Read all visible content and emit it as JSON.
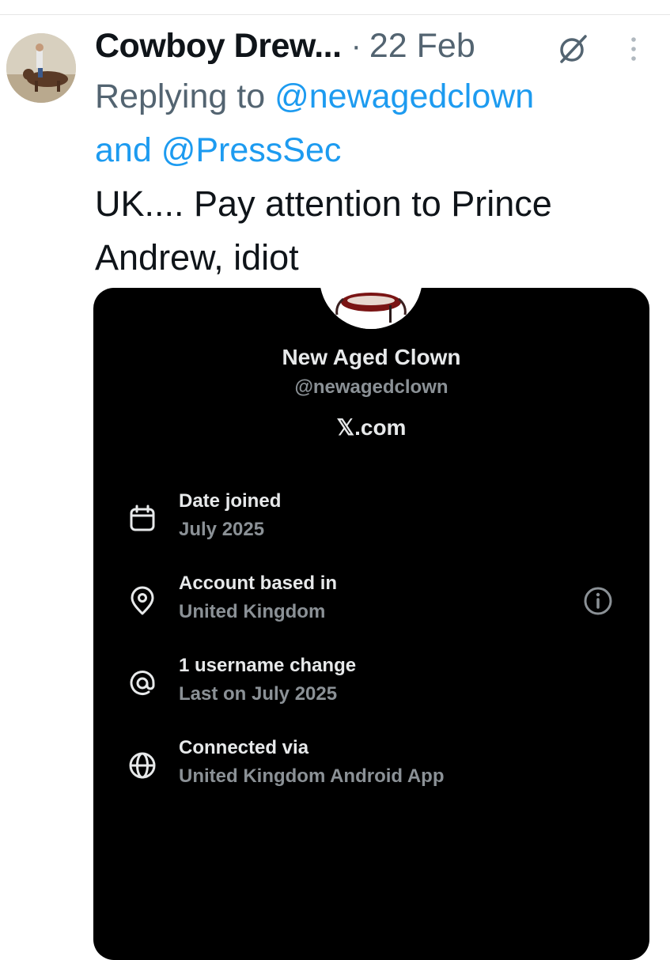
{
  "post": {
    "author": "Cowboy Drew...",
    "separator": "·",
    "date": "22 Feb",
    "reply_prefix": "Replying to",
    "mention_1": "@newagedclown",
    "reply_and": "and",
    "mention_2": "@PressSec",
    "text": "UK.... Pay attention to Prince Andrew, idiot"
  },
  "card": {
    "name": "New Aged Clown",
    "handle": "@newagedclown",
    "site": "𝕏.com",
    "rows": [
      {
        "label": "Date joined",
        "value": "July 2025",
        "icon": "calendar-icon"
      },
      {
        "label": "Account based in",
        "value": "United Kingdom",
        "icon": "location-pin-icon"
      },
      {
        "label": "1 username change",
        "value": "Last on July 2025",
        "icon": "at-sign-icon"
      },
      {
        "label": "Connected via",
        "value": "United Kingdom Android App",
        "icon": "globe-icon"
      }
    ]
  },
  "colors": {
    "mention": "#1d9bf0",
    "secondary_text": "#536471",
    "primary_text": "#0f1419",
    "card_bg": "#000000",
    "card_text": "#e7e9ea",
    "card_subtext": "#8b9196"
  }
}
